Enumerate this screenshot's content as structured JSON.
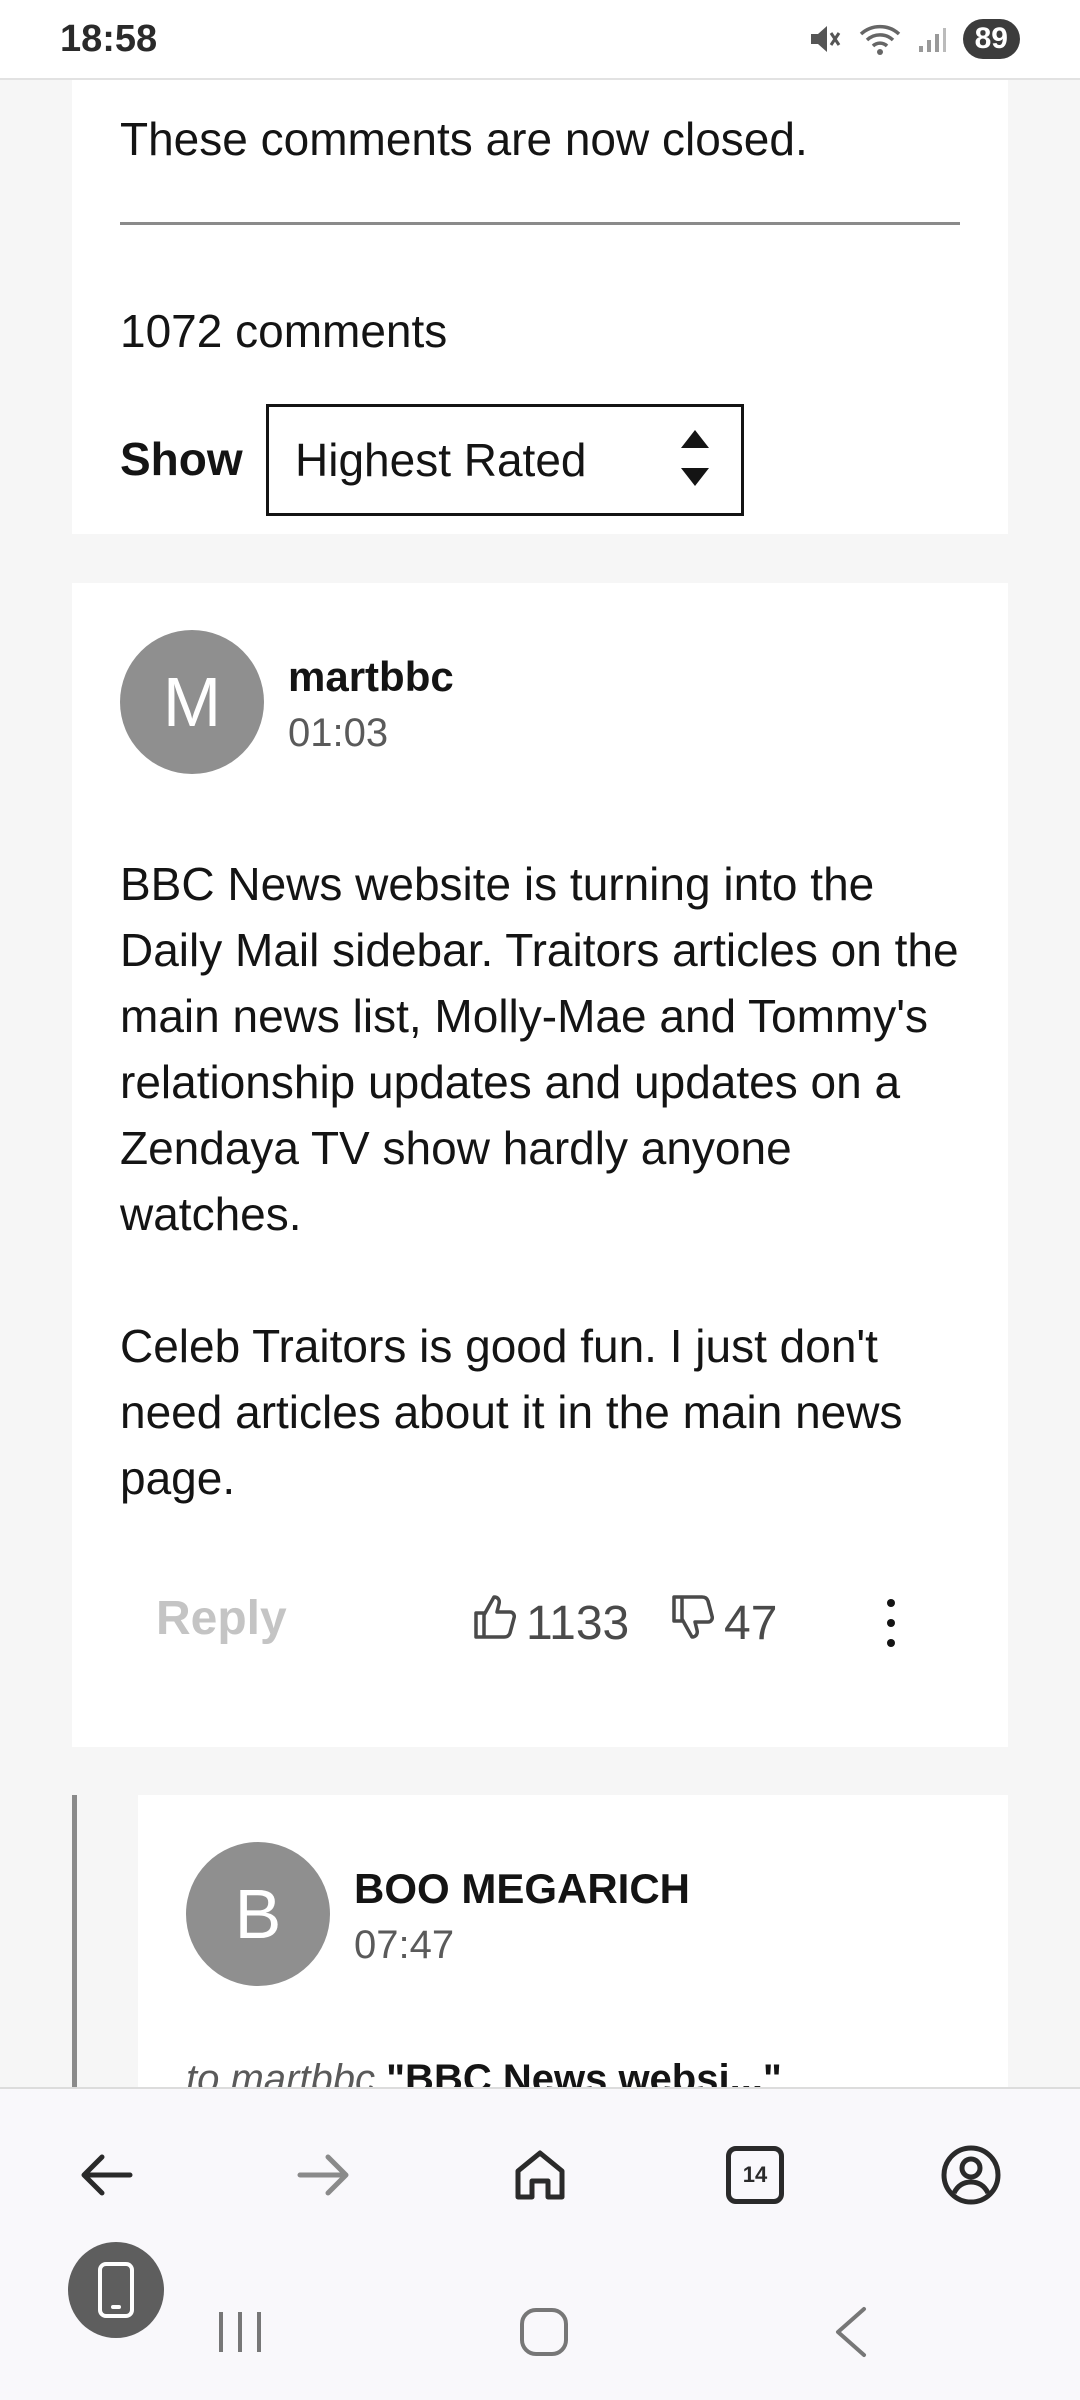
{
  "status_bar": {
    "time": "18:58",
    "battery": "89"
  },
  "comments_header": {
    "closed_message": "These comments are now closed.",
    "count": "1072 comments",
    "show_label": "Show",
    "sort_value": "Highest Rated"
  },
  "comment": {
    "avatar_letter": "M",
    "username": "martbbc",
    "time": "01:03",
    "paragraphs": [
      "BBC News website is turning into the Daily Mail sidebar. Traitors articles on the main news list, Molly-Mae and Tommy's relationship updates and updates on a Zendaya TV show hardly anyone watches.",
      "Celeb Traitors is good fun. I just don't need articles about it in the main news page."
    ],
    "reply_label": "Reply",
    "upvotes": "1133",
    "downvotes": "47"
  },
  "reply": {
    "avatar_letter": "B",
    "username": "BOO MEGARICH",
    "time": "07:47",
    "to_prefix": "to martbbc",
    "quote": "\"BBC News websi...\""
  },
  "browser_bar": {
    "tab_count": "14",
    "icons": [
      "back-arrow-icon",
      "forward-arrow-icon",
      "home-icon",
      "tabs-icon",
      "account-icon"
    ]
  },
  "colors": {
    "avatar_bg": "#8f8f8f",
    "reply_disabled": "#c4c4c4",
    "page_bg": "#f6f6f6"
  }
}
